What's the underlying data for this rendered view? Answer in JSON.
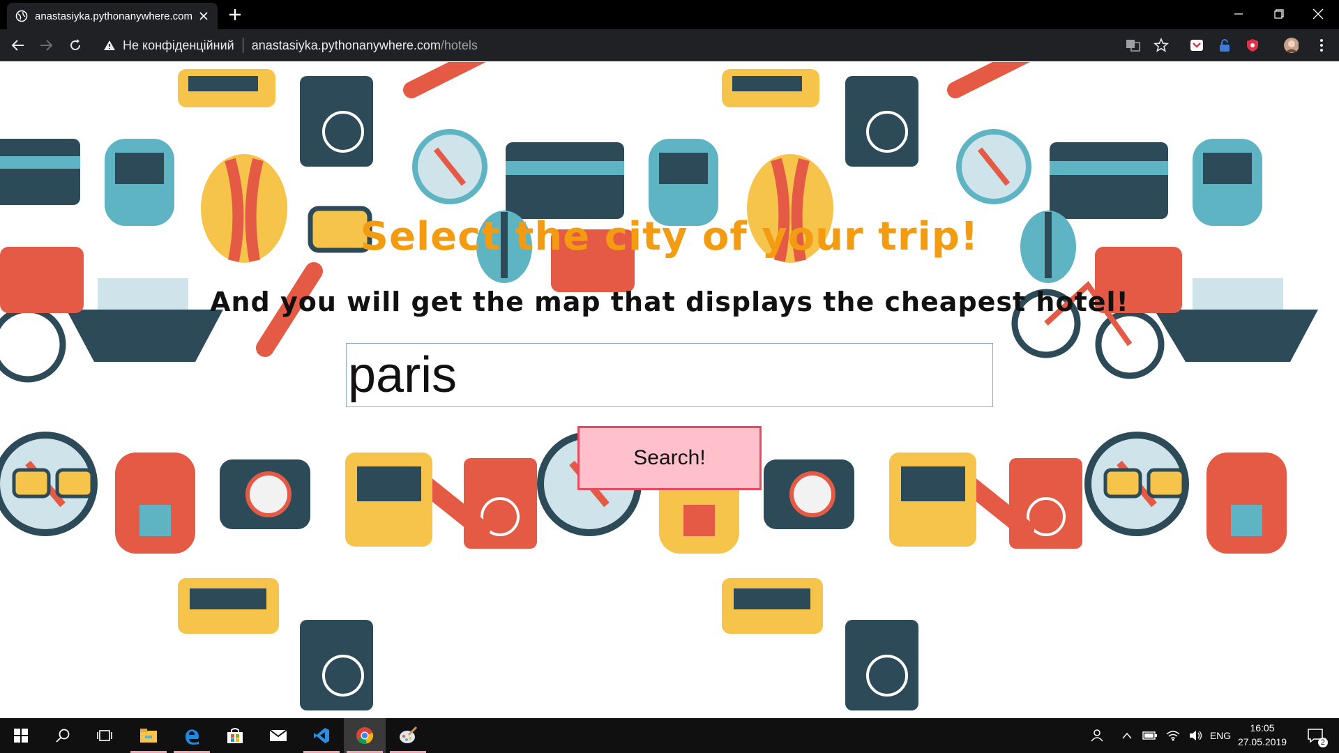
{
  "browser": {
    "tab_title": "anastasiyka.pythonanywhere.com/hotels",
    "security_label": "Не конфіденційний",
    "url_host": "anastasiyka.pythonanywhere.com",
    "url_path": "/hotels"
  },
  "page": {
    "heading": "Select the city of your trip!",
    "subheading": "And you will get the map that displays the cheapest hotel!",
    "search": {
      "value": "paris"
    },
    "search_button": "Search!"
  },
  "colors": {
    "heading": "#f39c12",
    "button_bg": "#ffc0cb",
    "button_border": "#e84a5f"
  },
  "taskbar": {
    "language": "ENG",
    "time": "16:05",
    "date": "27.05.2019",
    "notifications": "2",
    "apps": [
      "start-icon",
      "search-icon",
      "task-view-icon",
      "file-explorer-icon",
      "edge-icon",
      "store-icon",
      "mail-icon",
      "vscode-icon",
      "chrome-icon",
      "paint-icon"
    ]
  }
}
